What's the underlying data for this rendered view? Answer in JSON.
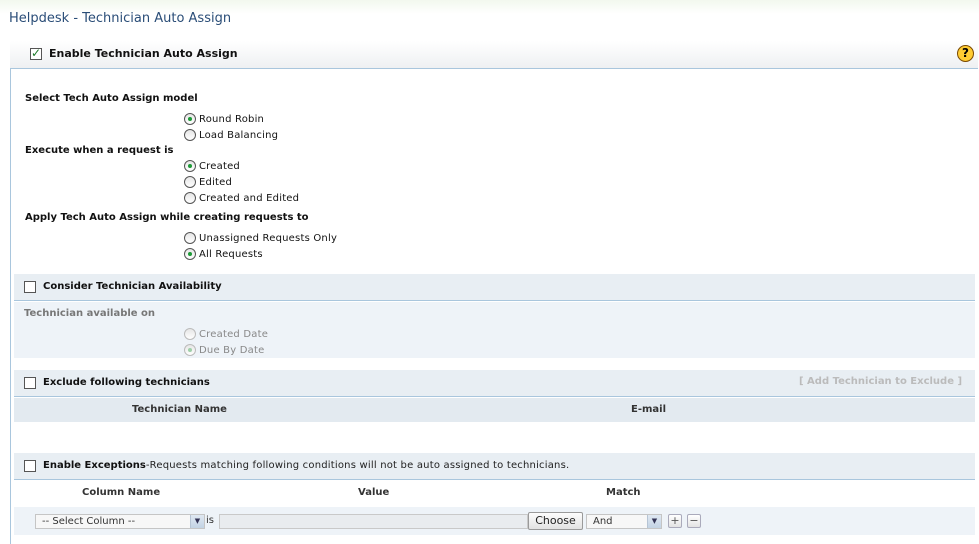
{
  "page": {
    "title": "Helpdesk - Technician Auto Assign"
  },
  "header": {
    "enable_label": "Enable Technician Auto Assign",
    "enabled": true,
    "help_symbol": "?"
  },
  "model": {
    "label": "Select Tech Auto Assign model",
    "options": [
      {
        "label": "Round Robin",
        "selected": true
      },
      {
        "label": "Load Balancing",
        "selected": false
      }
    ]
  },
  "execute": {
    "label": "Execute when a request is",
    "options": [
      {
        "label": "Created",
        "selected": true
      },
      {
        "label": "Edited",
        "selected": false
      },
      {
        "label": "Created and Edited",
        "selected": false
      }
    ]
  },
  "apply": {
    "label": "Apply Tech Auto Assign while creating requests to",
    "options": [
      {
        "label": "Unassigned Requests Only",
        "selected": false
      },
      {
        "label": "All Requests",
        "selected": true
      }
    ]
  },
  "availability": {
    "checkbox_label": "Consider Technician Availability",
    "checked": false,
    "sub_label": "Technician available on",
    "options": [
      {
        "label": "Created Date",
        "selected": false
      },
      {
        "label": "Due By Date",
        "selected": true
      }
    ]
  },
  "exclude": {
    "checkbox_label": "Exclude following technicians",
    "checked": false,
    "add_link": "[  Add Technician to Exclude  ]",
    "columns": [
      "Technician Name",
      "E-mail"
    ]
  },
  "exceptions": {
    "checkbox_label": "Enable Exceptions",
    "note": "-Requests matching following conditions will not be auto assigned to technicians.",
    "checked": false,
    "columns": [
      "Column Name",
      "Value",
      "Match"
    ],
    "row": {
      "column_select": "-- Select Column --",
      "is_label": "is",
      "value": "",
      "choose_label": "Choose",
      "match_select": "And",
      "add_symbol": "+",
      "remove_symbol": "−"
    }
  }
}
